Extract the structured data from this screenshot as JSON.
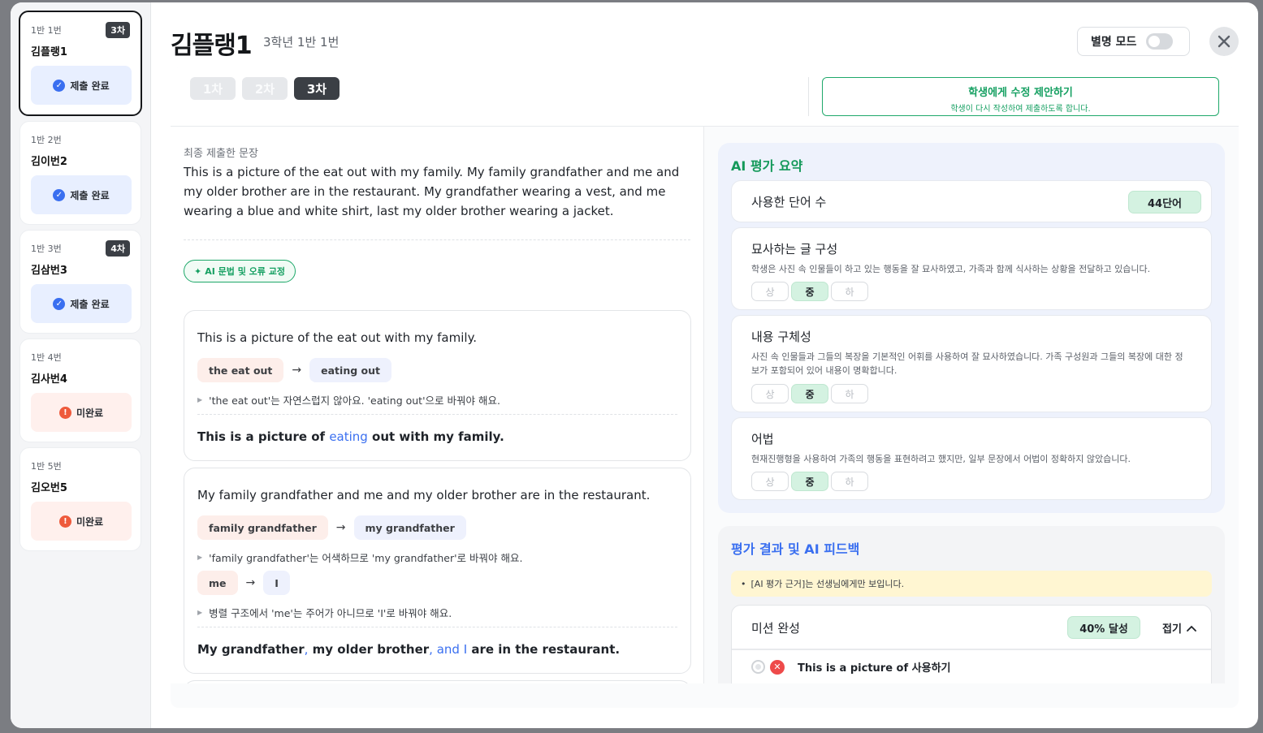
{
  "students": [
    {
      "num": "1반 1번",
      "name": "김플랭1",
      "round": "3차",
      "status": "제출 완료",
      "state": "done",
      "active": true
    },
    {
      "num": "1반 2번",
      "name": "김이번2",
      "round": "",
      "status": "제출 완료",
      "state": "done",
      "active": false
    },
    {
      "num": "1반 3번",
      "name": "김삼번3",
      "round": "4차",
      "status": "제출 완료",
      "state": "done",
      "active": false
    },
    {
      "num": "1반 4번",
      "name": "김사번4",
      "round": "",
      "status": "미완료",
      "state": "todo",
      "active": false
    },
    {
      "num": "1반 5번",
      "name": "김오번5",
      "round": "",
      "status": "미완료",
      "state": "todo",
      "active": false
    }
  ],
  "header": {
    "title": "김플랭1",
    "subtitle": "3학년 1반 1번",
    "anon_mode_label": "별명 모드",
    "anon_mode_on": false
  },
  "rounds": [
    "1차",
    "2차",
    "3차"
  ],
  "selected_round": "3차",
  "suggest": {
    "title": "학생에게 수정 제안하기",
    "subtitle": "학생이 다시 작성하여 제출하도록 합니다."
  },
  "submission": {
    "label": "최종 제출한 문장",
    "text": "This is a picture of the eat out with my family. My family grandfather and me and my older brother are in the restaurant. My grandfather wearing a vest, and me wearing a blue and white shirt, last my older brother wearing a jacket."
  },
  "ai_correction_chip": "AI 문법 및 오류 교정",
  "corrections": [
    {
      "original": "This is a picture of the eat out with my family.",
      "fixes": [
        {
          "from": "the eat out",
          "to": "eating out",
          "explanation": "'the eat out'는 자연스럽지 않아요. 'eating out'으로 바꿔야 해요."
        }
      ],
      "final_parts": [
        "This is a picture of ",
        "eating",
        " out with my family."
      ]
    },
    {
      "original": "My family grandfather and me and my older brother are in the restaurant.",
      "fixes": [
        {
          "from": "family grandfather",
          "to": "my grandfather",
          "explanation": "'family grandfather'는 어색하므로 'my grandfather'로 바꿔야 해요."
        },
        {
          "from": "me",
          "to": "I",
          "explanation": "병렬 구조에서 'me'는 주어가 아니므로 'I'로 바꿔야 해요."
        }
      ],
      "final_parts": [
        "My grandfather",
        ",",
        " my older brother",
        ",",
        " and I",
        " are in the restaurant."
      ]
    }
  ],
  "summary": {
    "title": "AI 평가 요약",
    "word_count_label": "사용한 단어 수",
    "word_count_value": "44단어",
    "grades": [
      "상",
      "중",
      "하"
    ],
    "criteria": [
      {
        "title": "묘사하는 글 구성",
        "desc": "학생은 사진 속 인물들이 하고 있는 행동을 잘 묘사하였고, 가족과 함께 식사하는 상황을 전달하고 있습니다.",
        "selected": "중"
      },
      {
        "title": "내용 구체성",
        "desc": "사진 속 인물들과 그들의 복장을 기본적인 어휘를 사용하여 잘 묘사하였습니다. 가족 구성원과 그들의 복장에 대한 정보가 포함되어 있어 내용이 명확합니다.",
        "selected": "중"
      },
      {
        "title": "어법",
        "desc": "현재진행형을 사용하여 가족의 행동을 표현하려고 했지만, 일부 문장에서 어법이 정확하지 않았습니다.",
        "selected": "중"
      }
    ]
  },
  "feedback": {
    "title": "평가 결과 및 AI 피드백",
    "notice": "[AI 평가 근거]는 선생님에게만 보입니다.",
    "mission_title": "미션 완성",
    "mission_achieve": "40% 달성",
    "collapse_label": "접기",
    "mission_items": [
      "This is a picture of 사용하기"
    ]
  },
  "colors": {
    "accent_blue": "#3a6ff0",
    "accent_green": "#16a062",
    "alert_red": "#ee5a3c"
  }
}
